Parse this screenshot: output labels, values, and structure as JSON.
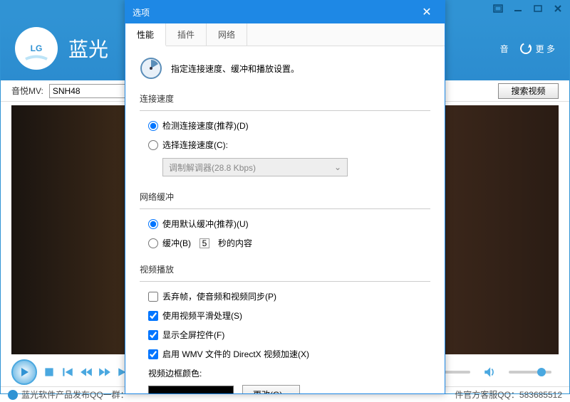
{
  "titlebar": {
    "min": "—",
    "max": "□",
    "close": "✕",
    "extra": "▣"
  },
  "header": {
    "logo": "LG",
    "app_name": "蓝光",
    "rec_label": "音",
    "more_label": "更 多"
  },
  "search": {
    "label": "音悦MV:",
    "value": "SNH48",
    "button": "搜索视频"
  },
  "footer": {
    "left": "蓝光软件产品发布QQ一群：",
    "right": "件官方客服QQ：583685512"
  },
  "dialog": {
    "title": "选项",
    "tabs": [
      "性能",
      "插件",
      "网络"
    ],
    "intro": "指定连接速度、缓冲和播放设置。",
    "s1": {
      "title": "连接速度",
      "r1": "检测连接速度(推荐)(D)",
      "r2": "选择连接速度(C):",
      "combo": "调制解调器(28.8 Kbps)"
    },
    "s2": {
      "title": "网络缓冲",
      "r1": "使用默认缓冲(推荐)(U)",
      "r2": "缓冲(B)",
      "num": "5",
      "suffix": "秒的内容"
    },
    "s3": {
      "title": "视频播放",
      "c1": "丢弃帧，使音频和视频同步(P)",
      "c2": "使用视频平滑处理(S)",
      "c3": "显示全屏控件(F)",
      "c4": "启用 WMV 文件的 DirectX 视频加速(X)",
      "border_label": "视频边框颜色:",
      "change": "更改(G)..."
    }
  }
}
